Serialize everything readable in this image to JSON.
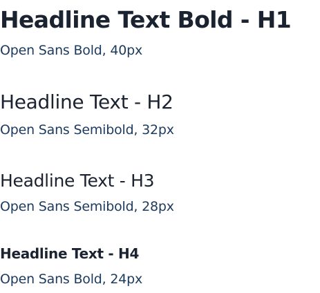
{
  "typography": {
    "h1": {
      "sample": "Headline Text Bold - H1",
      "spec": "Open Sans Bold, 40px"
    },
    "h2": {
      "sample": "Headline Text - H2",
      "spec": "Open Sans Semibold, 32px"
    },
    "h3": {
      "sample": "Headline Text - H3",
      "spec": "Open Sans Semibold, 28px"
    },
    "h4": {
      "sample": "Headline Text - H4",
      "spec": "Open Sans Bold, 24px"
    }
  },
  "colors": {
    "heading": "#1b2330",
    "caption": "#1c3a5e",
    "background": "#ffffff"
  }
}
